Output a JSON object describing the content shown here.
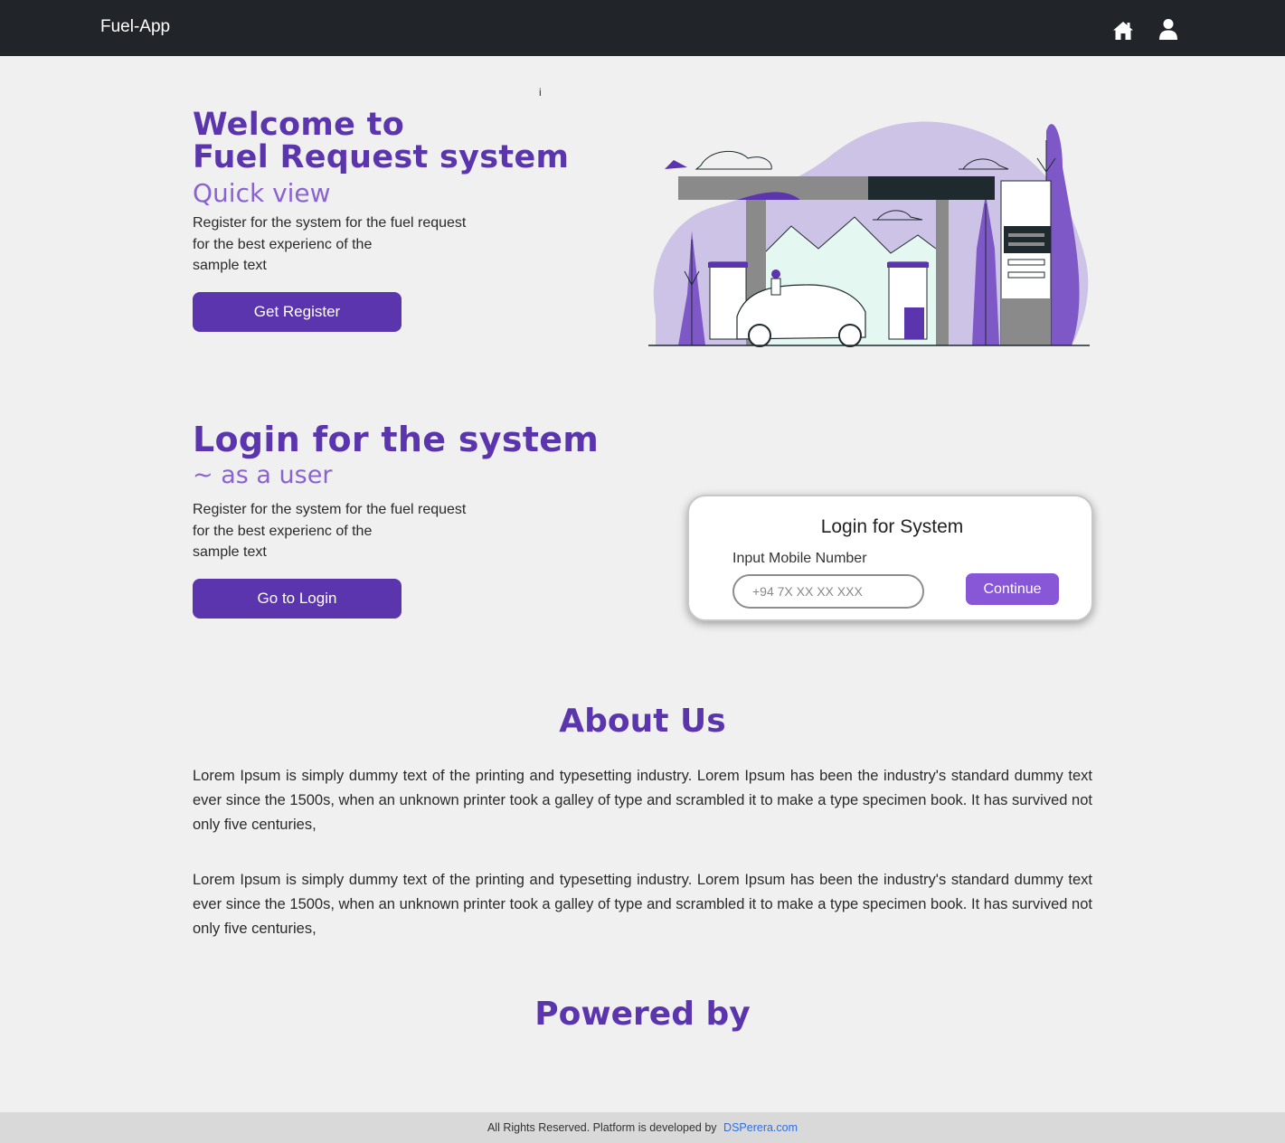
{
  "navbar": {
    "brand": "Fuel-App",
    "icons": [
      "home-icon",
      "user-icon"
    ]
  },
  "stray_text": "i",
  "hero": {
    "title_line1": "Welcome to",
    "title_line2": "Fuel Request system",
    "subtitle": "Quick view",
    "desc_line1": "Register for the system for the fuel request",
    "desc_line2": "for the best experienc of the",
    "desc_line3": "sample text",
    "button": "Get Register"
  },
  "login_section": {
    "title": "Login for the system",
    "subtitle": "~ as a user",
    "desc_line1": "Register for the system for the fuel request",
    "desc_line2": "for the best experienc of the",
    "desc_line3": "sample text",
    "button": "Go to Login"
  },
  "login_card": {
    "title": "Login for System",
    "label": "Input Mobile Number",
    "placeholder": "+94 7X XX XX XXX",
    "button": "Continue"
  },
  "about": {
    "title": "About Us",
    "paragraphs": [
      "Lorem Ipsum is simply dummy text of the printing and typesetting industry. Lorem Ipsum has been the industry's standard dummy text ever since the 1500s, when an unknown printer took a galley of type and scrambled it to make a type specimen book. It has survived not only five centuries,",
      "Lorem Ipsum is simply dummy text of the printing and typesetting industry. Lorem Ipsum has been the industry's standard dummy text ever since the 1500s, when an unknown printer took a galley of type and scrambled it to make a type specimen book. It has survived not only five centuries,"
    ]
  },
  "powered": {
    "title": "Powered by"
  },
  "footer": {
    "text": "All Rights Reserved. Platform is developed by",
    "link": "DSPerera.com"
  },
  "colors": {
    "primary": "#5b35ad",
    "accent": "#8a63d2",
    "navbar": "#212529",
    "background": "#f0f0f0"
  }
}
